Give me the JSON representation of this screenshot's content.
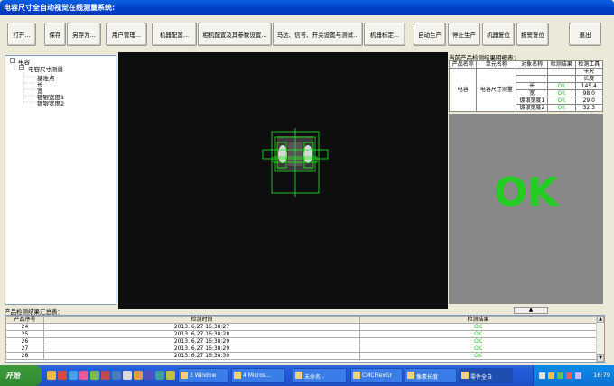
{
  "window": {
    "title": "电容尺寸全自动视觉在线测量系统:"
  },
  "toolbar": [
    {
      "label": "打开..."
    },
    {
      "label": "保存"
    },
    {
      "label": "另存为..."
    },
    {
      "label": "用户管理..."
    },
    {
      "label": "机器配置..."
    },
    {
      "label": "相机配置及其参数设置..."
    },
    {
      "label": "马达、信号、开关设置与测试..."
    },
    {
      "label": "机器标定..."
    },
    {
      "label": "自动生产"
    },
    {
      "label": "停止生产"
    },
    {
      "label": "机器复位"
    },
    {
      "label": "报警复位"
    },
    {
      "label": "退出"
    }
  ],
  "tree": {
    "root": "电容",
    "child": "电容尺寸测量",
    "leaves": [
      "基准点",
      "长",
      "宽",
      "镀银宽度1",
      "镀银宽度2"
    ],
    "expander_symbol": "−"
  },
  "result_panel": {
    "title": "当前产品检测结果明细表：",
    "headers": [
      "产品名称",
      "单元名称",
      "对象名称",
      "检测结果",
      "检测工具"
    ],
    "product_name": "电容",
    "unit_name": "电容尺寸测量",
    "tool_header_sub": [
      "卡尺",
      "长度"
    ],
    "rows": [
      {
        "object": "长",
        "result": "OK",
        "value": "145.4"
      },
      {
        "object": "宽",
        "result": "OK",
        "value": "98.0"
      },
      {
        "object": "镀银宽度1",
        "result": "OK",
        "value": "29.0"
      },
      {
        "object": "镀银宽度2",
        "result": "OK",
        "value": "32.3"
      }
    ],
    "big_status": "OK",
    "up_button": "▲"
  },
  "summary": {
    "title": "产品检测结果汇总表：",
    "headers": [
      "产品序号",
      "检测时间",
      "检测结果"
    ],
    "rows": [
      {
        "no": "24",
        "time": "2013. 6.27 16:38:27",
        "result": "OK"
      },
      {
        "no": "25",
        "time": "2013. 6.27 16:38:28",
        "result": "OK"
      },
      {
        "no": "26",
        "time": "2013. 6.27 16:38:29",
        "result": "OK"
      },
      {
        "no": "27",
        "time": "2013. 6.27 16:38:29",
        "result": "OK"
      },
      {
        "no": "28",
        "time": "2013. 6.27 16:38:30",
        "result": "OK"
      }
    ],
    "scroll_up": "▲",
    "scroll_down": "▼"
  },
  "taskbar": {
    "start": "开始",
    "tasks": [
      {
        "label": "3 Window"
      },
      {
        "label": "4 Micros..."
      },
      {
        "label": "未命名 -"
      },
      {
        "label": "CMCFlexGr"
      },
      {
        "label": "像素长度"
      },
      {
        "label": "零件全自"
      }
    ],
    "clock": "16:79"
  },
  "colors": {
    "ok_green": "#22cc22",
    "roi_green": "#22ee22",
    "title_blue": "#0040c8"
  }
}
